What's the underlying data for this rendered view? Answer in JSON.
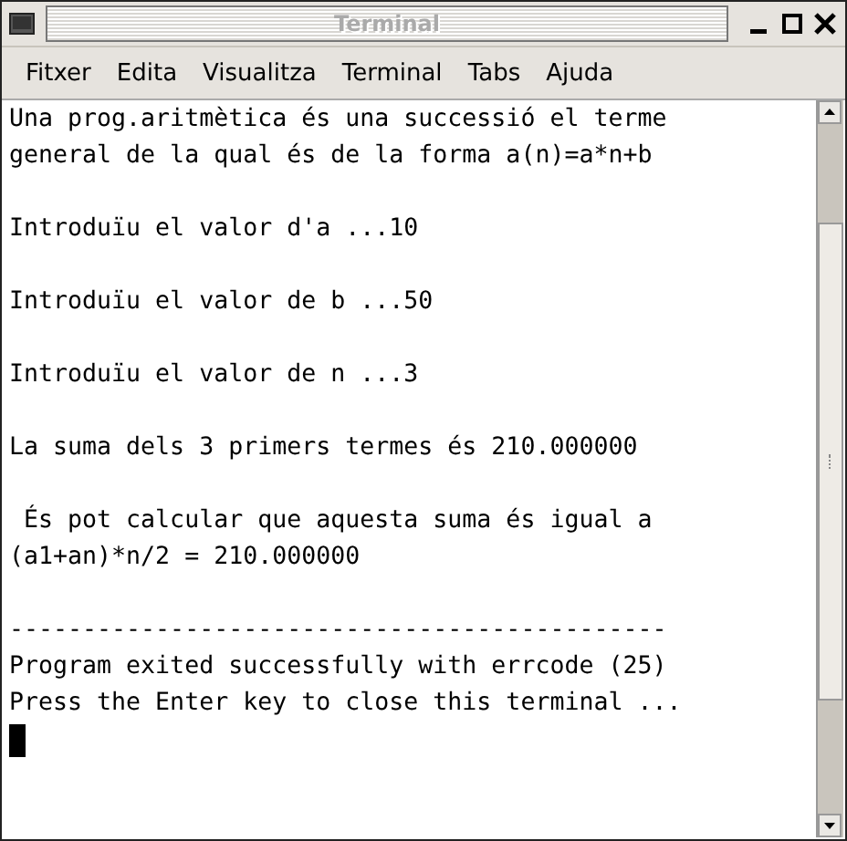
{
  "window": {
    "title": "Terminal"
  },
  "menu": [
    "Fitxer",
    "Edita",
    "Visualitza",
    "Terminal",
    "Tabs",
    "Ajuda"
  ],
  "terminal": {
    "blocks": [
      [
        "Una prog.aritmètica és una successió el terme",
        "general de la qual és de la forma a(n)=a*n+b"
      ],
      [
        "Introduïu el valor d'a ...10"
      ],
      [
        "Introduïu el valor de b ...50"
      ],
      [
        "Introduïu el valor de n ...3"
      ],
      [
        "La suma dels 3 primers termes és 210.000000"
      ],
      [
        " És pot calcular que aquesta suma és igual a",
        "(a1+an)*n/2 = 210.000000"
      ],
      [
        "---------------------------------------------",
        "Program exited successfully with errcode (25)",
        "Press the Enter key to close this terminal ..."
      ]
    ],
    "cursor": true
  }
}
